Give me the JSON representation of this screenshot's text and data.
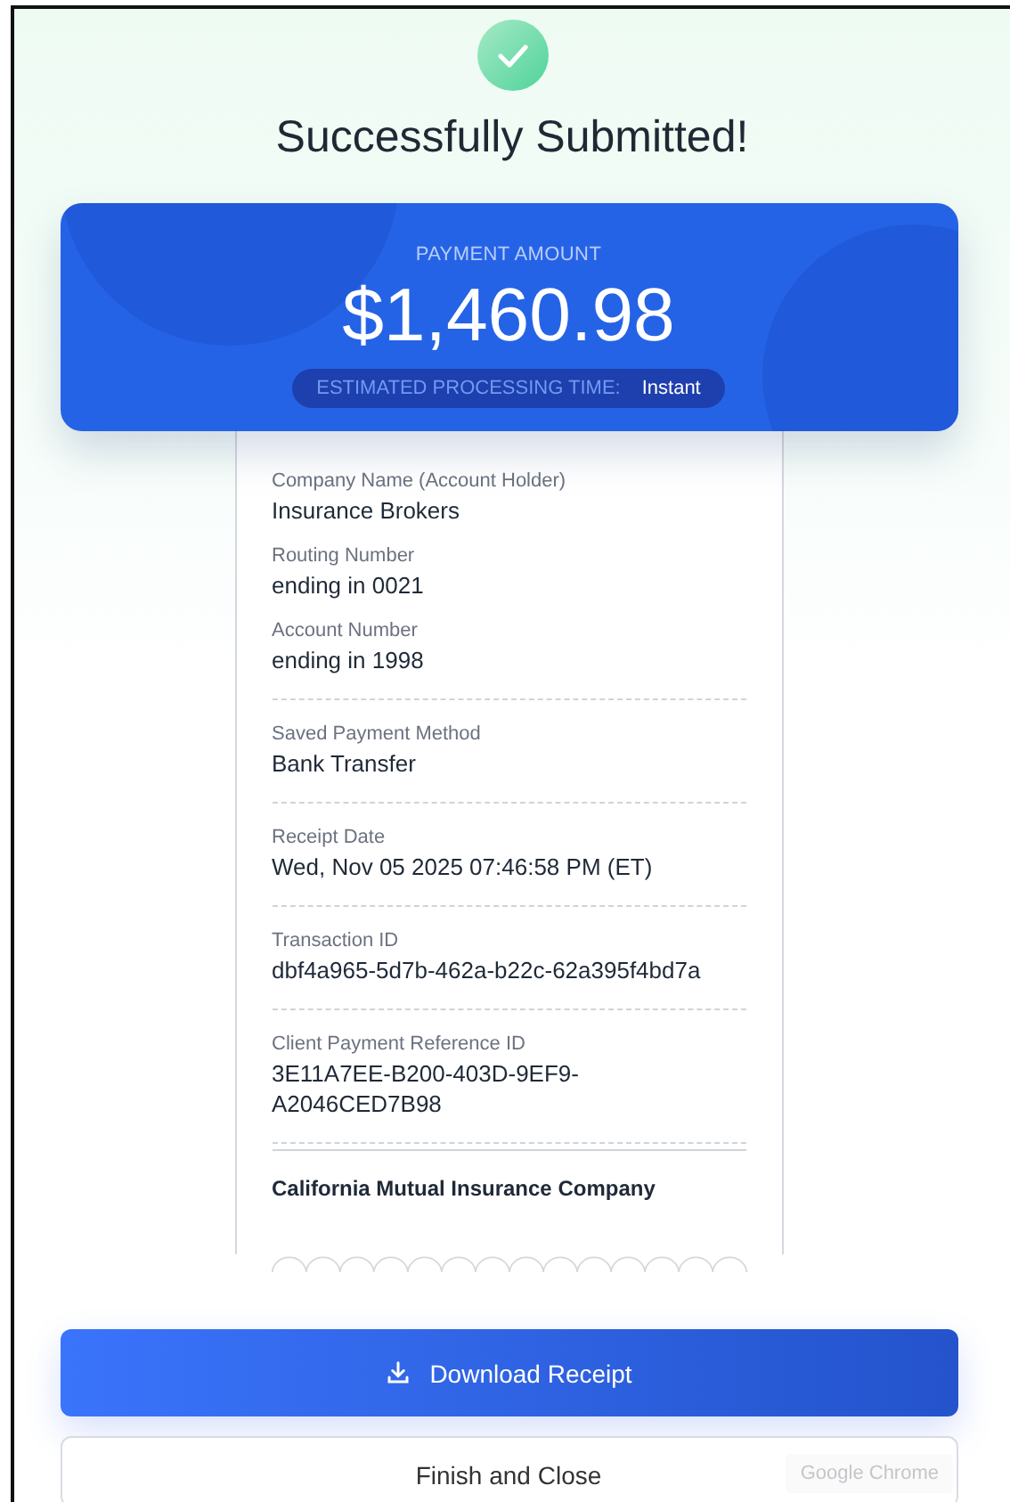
{
  "status": {
    "title": "Successfully Submitted!"
  },
  "payment": {
    "label": "PAYMENT AMOUNT",
    "amount": "$1,460.98",
    "processing_label": "ESTIMATED PROCESSING TIME:",
    "processing_value": "Instant"
  },
  "receipt": {
    "sections": [
      {
        "fields": [
          {
            "label": "Company Name (Account Holder)",
            "value": "Insurance Brokers"
          },
          {
            "label": "Routing Number",
            "value": "ending in 0021"
          },
          {
            "label": "Account Number",
            "value": "ending in 1998"
          }
        ]
      },
      {
        "fields": [
          {
            "label": "Saved Payment Method",
            "value": "Bank Transfer"
          }
        ]
      },
      {
        "fields": [
          {
            "label": "Receipt Date",
            "value": "Wed, Nov 05 2025 07:46:58 PM (ET)"
          }
        ]
      },
      {
        "fields": [
          {
            "label": "Transaction ID",
            "value": "dbf4a965-5d7b-462a-b22c-62a395f4bd7a"
          }
        ]
      },
      {
        "fields": [
          {
            "label": "Client Payment Reference ID",
            "value": "3E11A7EE-B200-403D-9EF9-A2046CED7B98"
          }
        ]
      }
    ],
    "footer": "California Mutual Insurance Company"
  },
  "buttons": [
    {
      "kind": "primary",
      "label": "Download Receipt"
    },
    {
      "kind": "secondary",
      "label": "Finish and Close"
    }
  ],
  "tooltip": "Google Chrome"
}
